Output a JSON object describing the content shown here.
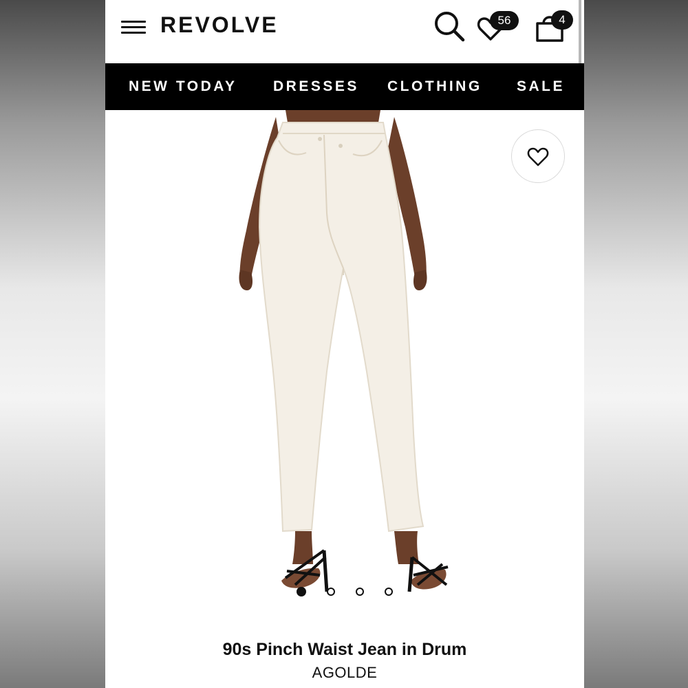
{
  "header": {
    "logo": "REVOLVE",
    "wishlist_count": "56",
    "bag_count": "4",
    "icons": [
      "menu-icon",
      "search-icon",
      "heart-icon",
      "shopping-bag-icon"
    ]
  },
  "nav": {
    "items": [
      {
        "label": "NEW TODAY"
      },
      {
        "label": "DRESSES"
      },
      {
        "label": "CLOTHING"
      },
      {
        "label": "SALE"
      }
    ]
  },
  "gallery": {
    "image_count": 4,
    "active_index": 0,
    "favorite_icon": "heart-outline-icon"
  },
  "product": {
    "name": "90s Pinch Waist Jean in Drum",
    "brand": "AGOLDE"
  },
  "colors": {
    "brand_black": "#000000",
    "background": "#ffffff",
    "jean_color": "#f4efe6"
  }
}
